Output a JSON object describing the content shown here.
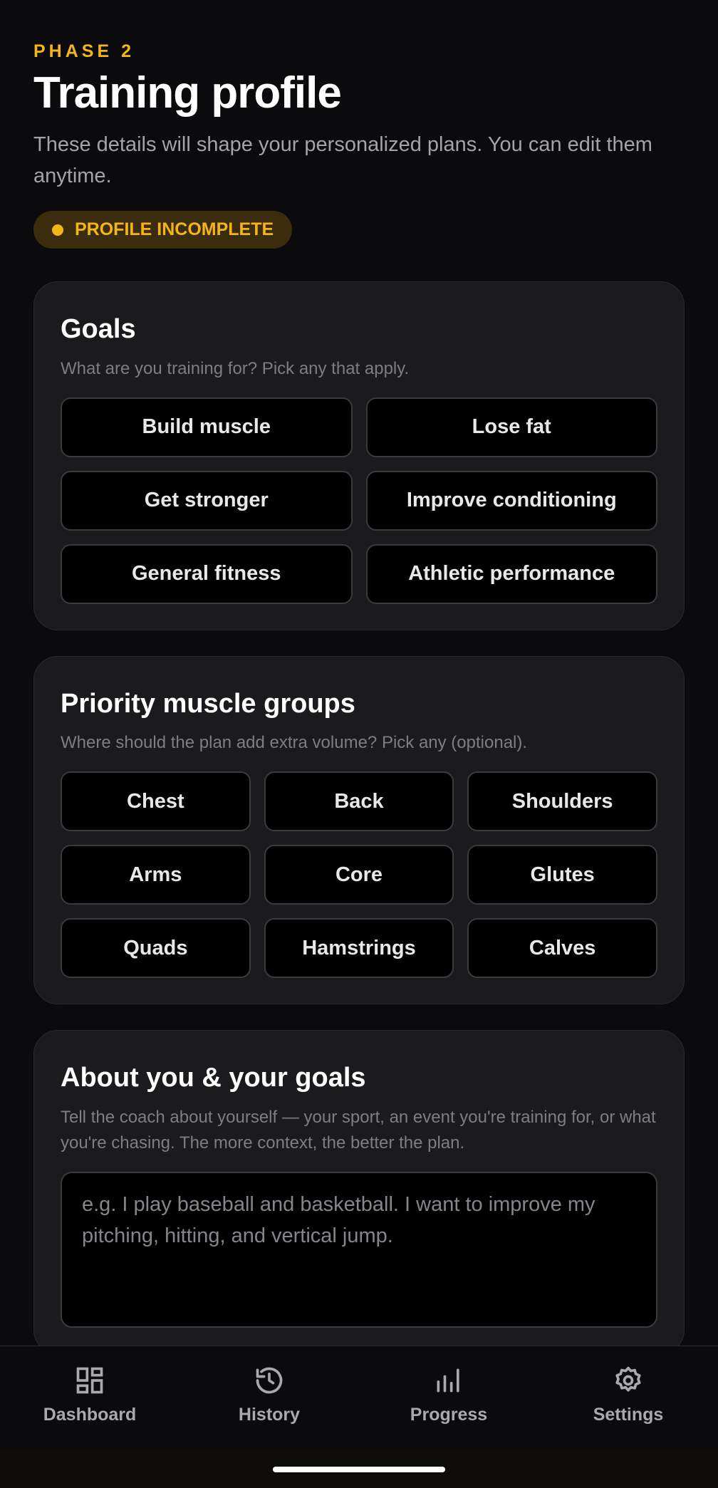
{
  "header": {
    "eyebrow": "PHASE 2",
    "title": "Training profile",
    "subtitle": "These details will shape your personalized plans. You can edit them anytime.",
    "badge": "PROFILE INCOMPLETE"
  },
  "goals": {
    "title": "Goals",
    "description": "What are you training for? Pick any that apply.",
    "options": [
      "Build muscle",
      "Lose fat",
      "Get stronger",
      "Improve conditioning",
      "General fitness",
      "Athletic performance"
    ]
  },
  "muscles": {
    "title": "Priority muscle groups",
    "description": "Where should the plan add extra volume? Pick any (optional).",
    "options": [
      "Chest",
      "Back",
      "Shoulders",
      "Arms",
      "Core",
      "Glutes",
      "Quads",
      "Hamstrings",
      "Calves"
    ]
  },
  "about": {
    "title": "About you & your goals",
    "description": "Tell the coach about yourself — your sport, an event you're training for, or what you're chasing. The more context, the better the plan.",
    "placeholder": "e.g. I play baseball and basketball. I want to improve my pitching, hitting, and vertical jump.",
    "value": ""
  },
  "tabs": [
    {
      "label": "Dashboard",
      "icon": "dashboard-icon"
    },
    {
      "label": "History",
      "icon": "history-icon"
    },
    {
      "label": "Progress",
      "icon": "progress-icon"
    },
    {
      "label": "Settings",
      "icon": "settings-icon"
    }
  ],
  "colors": {
    "accent": "#f5b418",
    "background": "#0b0b0d",
    "card": "#1b1b1e"
  }
}
